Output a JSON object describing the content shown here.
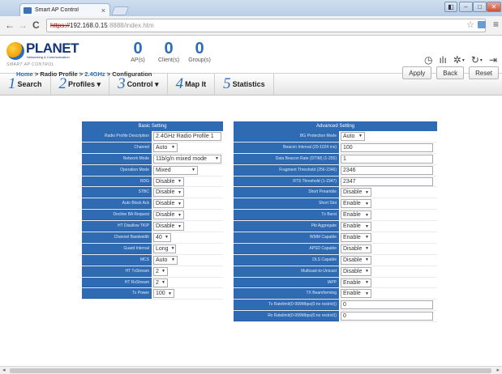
{
  "browser": {
    "tab_title": "Smart AP Control",
    "tab_close": "×",
    "url_scheme": "https://",
    "url_host": "192.168.0.15",
    "url_path": ":8888/index.htm",
    "back": "←",
    "forward": "→",
    "reload": "C",
    "star": "☆",
    "menu": "≡",
    "min": "–",
    "max": "□",
    "close": "✕",
    "extra": "◧"
  },
  "app": {
    "logo_text": "PLANET",
    "logo_sub": "Networking & Communication",
    "logo_smart": "SMART AP CONTROL",
    "counters": [
      {
        "value": "0",
        "label": "AP(s)"
      },
      {
        "value": "0",
        "label": "Client(s)"
      },
      {
        "value": "0",
        "label": "Group(s)"
      }
    ],
    "tools": {
      "dashboard": "◷",
      "chart": "ılı",
      "settings": "✲",
      "refresh": "↻",
      "logout": "⇥",
      "caret": "▾"
    },
    "nav": [
      {
        "num": "1",
        "label": "Search"
      },
      {
        "num": "2",
        "label": "Profiles ▾"
      },
      {
        "num": "3",
        "label": "Control ▾"
      },
      {
        "num": "4",
        "label": "Map It"
      },
      {
        "num": "5",
        "label": "Statistics"
      }
    ],
    "breadcrumb": {
      "home": "Home",
      "sep": " > ",
      "radio": "Radio Profile",
      "band": "2.4GHz",
      "page": "Configuration"
    },
    "actions": {
      "apply": "Apply",
      "back": "Back",
      "reset": "Reset"
    }
  },
  "basic": {
    "title": "Basic Setting",
    "rows": [
      {
        "label": "Radio Profile Description",
        "value": "2.4GHz Radio Profile 1",
        "kind": "text"
      },
      {
        "label": "Channel",
        "value": "Auto",
        "kind": "select"
      },
      {
        "label": "Network Mode",
        "value": "11b/g/n mixed mode",
        "kind": "select"
      },
      {
        "label": "Operation Mode",
        "value": "Mixed",
        "kind": "select"
      },
      {
        "label": "RDG",
        "value": "Disable",
        "kind": "select"
      },
      {
        "label": "STBC",
        "value": "Disable",
        "kind": "select"
      },
      {
        "label": "Auto Block Ack",
        "value": "Disable",
        "kind": "select"
      },
      {
        "label": "Decline BA Request",
        "value": "Disable",
        "kind": "select"
      },
      {
        "label": "HT Disallow TKIP",
        "value": "Disable",
        "kind": "select"
      },
      {
        "label": "Channel Bandwidth",
        "value": "40",
        "kind": "select"
      },
      {
        "label": "Guard Interval",
        "value": "Long",
        "kind": "select"
      },
      {
        "label": "MCS",
        "value": "Auto",
        "kind": "select"
      },
      {
        "label": "HT TxStream",
        "value": "2",
        "kind": "select"
      },
      {
        "label": "HT RxStream",
        "value": "2",
        "kind": "select"
      },
      {
        "label": "Tx Power",
        "value": "100",
        "kind": "select"
      }
    ]
  },
  "advanced": {
    "title": "Advanced Setting",
    "rows": [
      {
        "label": "BG Protection Mode",
        "value": "Auto",
        "kind": "select"
      },
      {
        "label": "Beacon Interval (20-1024 ms)",
        "value": "100",
        "kind": "text"
      },
      {
        "label": "Data Beacon Rate (DTIM) (1-255)",
        "value": "1",
        "kind": "text"
      },
      {
        "label": "Fragment Threshold (256-2346)",
        "value": "2346",
        "kind": "text"
      },
      {
        "label": "RTS Threshold (1-2347)",
        "value": "2347",
        "kind": "text"
      },
      {
        "label": "Short Preamble",
        "value": "Disable",
        "kind": "select"
      },
      {
        "label": "Short Slot",
        "value": "Enable",
        "kind": "select"
      },
      {
        "label": "Tx Burst",
        "value": "Enable",
        "kind": "select"
      },
      {
        "label": "Pkt Aggregate",
        "value": "Enable",
        "kind": "select"
      },
      {
        "label": "WMM Capable",
        "value": "Enable",
        "kind": "select"
      },
      {
        "label": "APSD Capable",
        "value": "Disable",
        "kind": "select"
      },
      {
        "label": "DLS Capable",
        "value": "Disable",
        "kind": "select"
      },
      {
        "label": "Multicast-to-Unicast",
        "value": "Disable",
        "kind": "select"
      },
      {
        "label": "IAPP",
        "value": "Enable",
        "kind": "select"
      },
      {
        "label": "TX Beamforming",
        "value": "Enable",
        "kind": "select"
      },
      {
        "label": "Tx Ratelimit(0-999Mbps(0:no restrict))",
        "value": "0",
        "kind": "text"
      },
      {
        "label": "Rx Ratelimit(0-999Mbps(0:no restrict))",
        "value": "0",
        "kind": "text"
      }
    ]
  }
}
